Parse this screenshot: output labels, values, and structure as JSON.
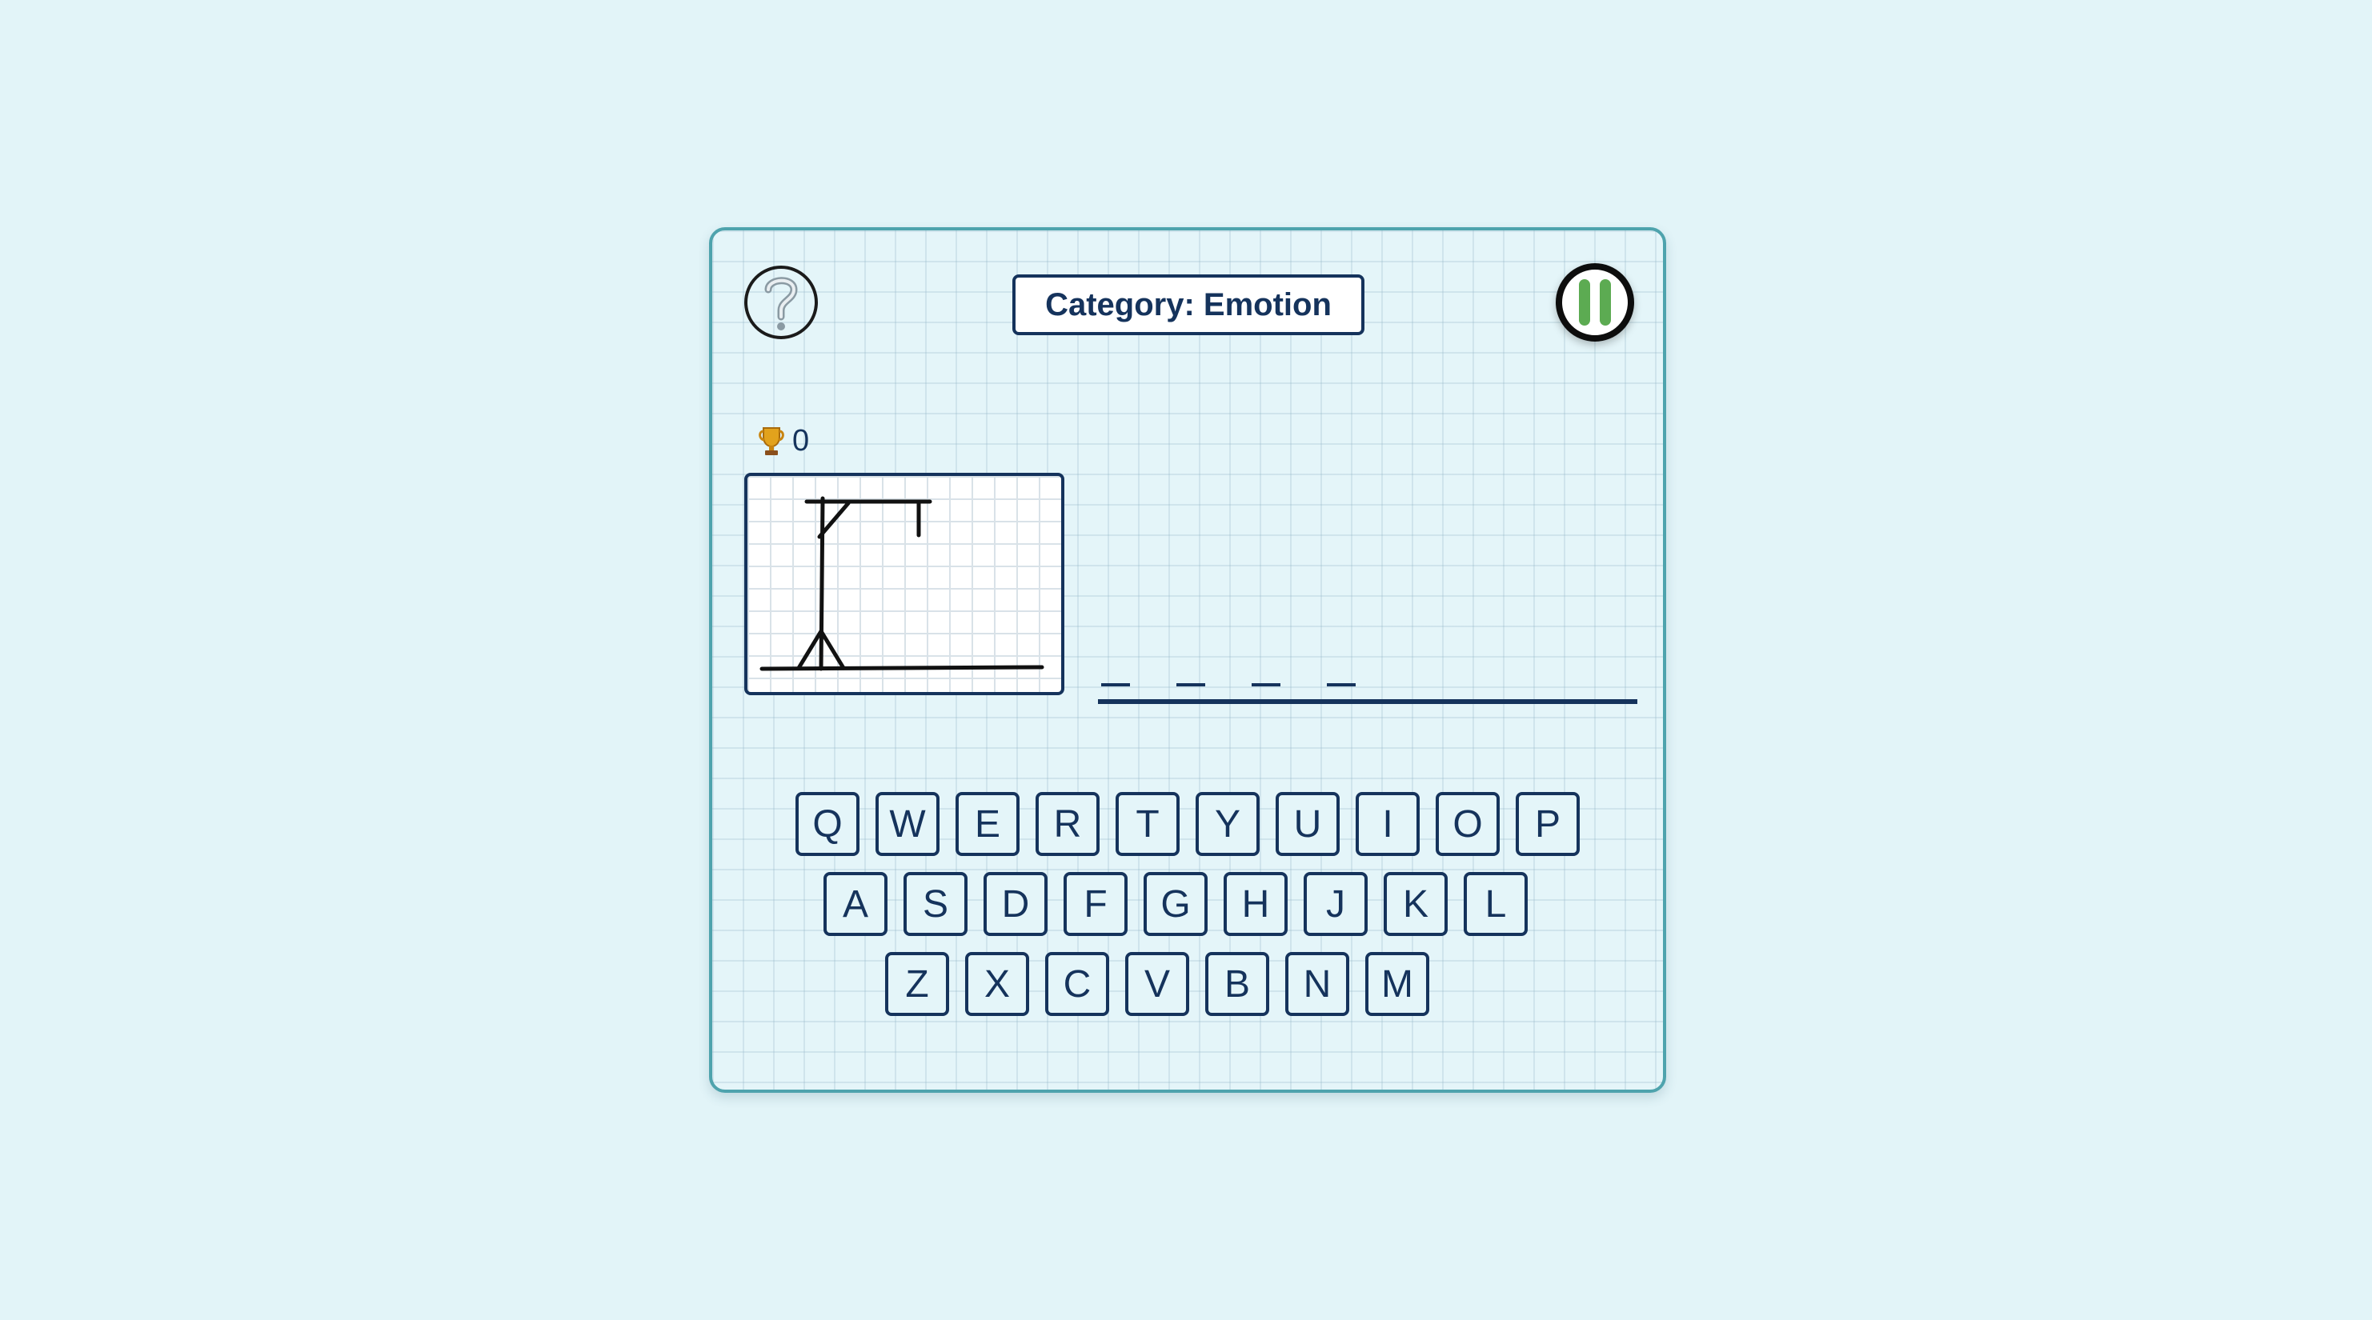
{
  "header": {
    "help_icon": "question-mark-icon",
    "category_label": "Category: Emotion",
    "pause_icon": "pause-icon"
  },
  "score": {
    "icon": "trophy-icon",
    "value": "0"
  },
  "gallows": {
    "stage": "gallows-only"
  },
  "word": {
    "letter_count": 4,
    "revealed": [
      "",
      "",
      "",
      ""
    ]
  },
  "keyboard": {
    "row1": [
      "Q",
      "W",
      "E",
      "R",
      "T",
      "Y",
      "U",
      "I",
      "O",
      "P"
    ],
    "row2": [
      "A",
      "S",
      "D",
      "F",
      "G",
      "H",
      "J",
      "K",
      "L"
    ],
    "row3": [
      "Z",
      "X",
      "C",
      "V",
      "B",
      "N",
      "M"
    ]
  },
  "colors": {
    "background": "#e2f4f8",
    "card_border": "#4ea3ad",
    "text": "#15335c",
    "pause_accent": "#5cab52"
  }
}
